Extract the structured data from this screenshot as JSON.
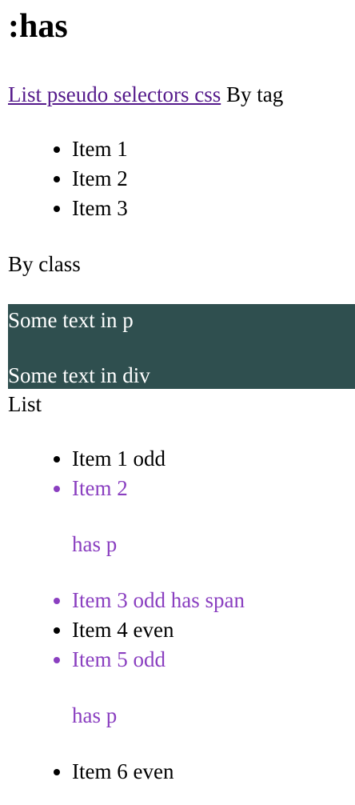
{
  "page": {
    "title": ":has"
  },
  "nav": {
    "link_text": "List pseudo selectors css",
    "after_text": " By tag"
  },
  "tag_list": [
    {
      "text": "Item 1"
    },
    {
      "text": "Item 2"
    },
    {
      "text": "Item 3"
    }
  ],
  "by_class": {
    "label": "By class",
    "box_bg": "#2f4f4f",
    "text_p": "Some text in p",
    "text_div": "Some text in div"
  },
  "list_section": {
    "label": "List",
    "highlight_color": "#8a3fc0",
    "items": [
      {
        "text": "Item 1 odd"
      },
      {
        "text": "Item 2",
        "child_p": "has p"
      },
      {
        "text": "Item 3 odd has span"
      },
      {
        "text": "Item 4 even"
      },
      {
        "text": "Item 5 odd",
        "child_p": "has p"
      },
      {
        "text": "Item 6 even"
      }
    ]
  }
}
